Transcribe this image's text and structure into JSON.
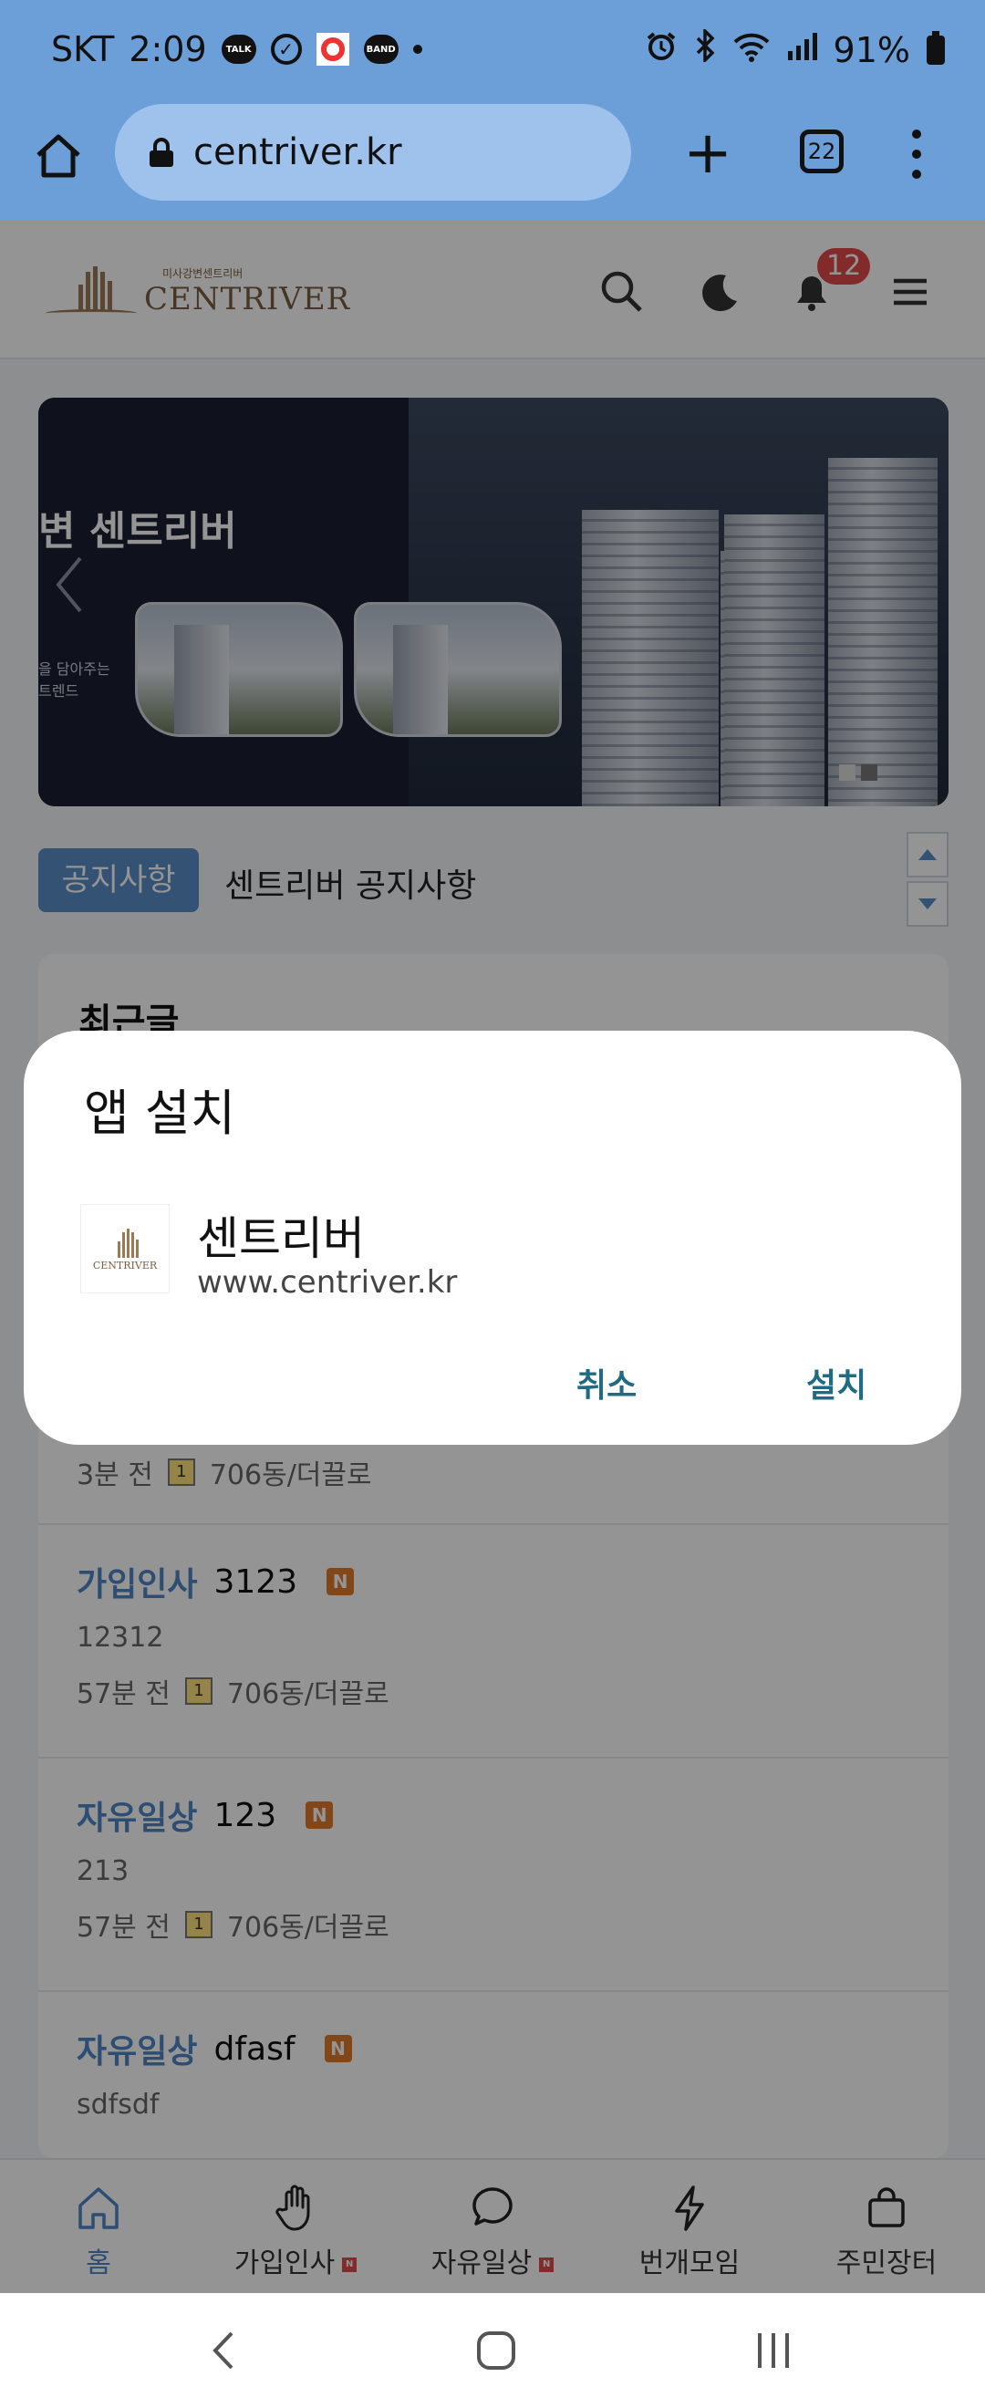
{
  "status_bar": {
    "carrier": "SKT",
    "time": "2:09",
    "notif_icons": [
      "TALK",
      "BAND"
    ],
    "battery": "91%"
  },
  "browser": {
    "url": "centriver.kr",
    "tab_count": "22"
  },
  "site": {
    "logo_sub": "미사강변센트리버",
    "logo_main": "CENTRIVER",
    "notification_count": "12"
  },
  "banner": {
    "title": "변 센트리버",
    "sub_line1": "을 담아주는",
    "sub_line2": "트렌드"
  },
  "notice": {
    "badge": "공지사항",
    "text": "센트리버 공지사항"
  },
  "recent": {
    "title": "최근글",
    "first_meta": {
      "time": "3분 전",
      "level": "1",
      "author": "706동/더끌로"
    },
    "posts": [
      {
        "category": "가입인사",
        "title": "3123",
        "badge": "N",
        "body": "12312",
        "time": "57분 전",
        "level": "1",
        "author": "706동/더끌로"
      },
      {
        "category": "자유일상",
        "title": "123",
        "badge": "N",
        "body": "213",
        "time": "57분 전",
        "level": "1",
        "author": "706동/더끌로"
      },
      {
        "category": "자유일상",
        "title": "dfasf",
        "badge": "N",
        "body": "sdfsdf",
        "time": "",
        "level": "",
        "author": ""
      }
    ]
  },
  "tabbar": {
    "items": [
      {
        "label": "홈",
        "icon": "home-icon",
        "new": ""
      },
      {
        "label": "가입인사",
        "icon": "hand-icon",
        "new": "N"
      },
      {
        "label": "자유일상",
        "icon": "chat-bubble-icon",
        "new": "N"
      },
      {
        "label": "번개모임",
        "icon": "lightning-icon",
        "new": ""
      },
      {
        "label": "주민장터",
        "icon": "shopping-bag-icon",
        "new": ""
      }
    ]
  },
  "dialog": {
    "title": "앱 설치",
    "app_name": "센트리버",
    "app_url": "www.centriver.kr",
    "icon_label": "CENTRIVER",
    "cancel": "취소",
    "install": "설치"
  },
  "colors": {
    "browser_bar": "#6c9ed8",
    "accent_blue": "#4f86c6",
    "dialog_button": "#1f6b83",
    "new_badge": "#e07a2a",
    "notif_badge": "#e24b4b"
  }
}
